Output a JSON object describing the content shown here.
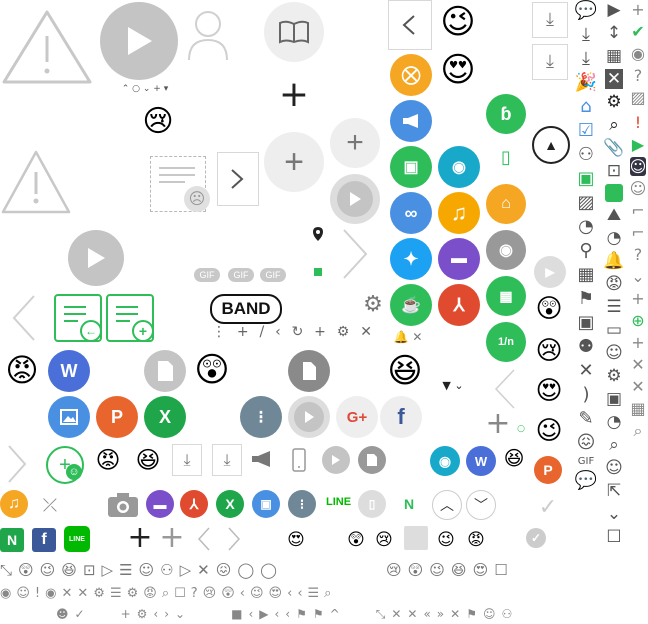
{
  "labels": {
    "band": "BAND",
    "gif": "GIF",
    "line": "LINE",
    "w": "W",
    "p": "P",
    "x": "X",
    "n": "N",
    "g_plus": "G+",
    "f": "f",
    "one_over_n": "1/n"
  },
  "colors": {
    "orange": "#f5a623",
    "blue": "#4a90e2",
    "green": "#2ebd59",
    "purple": "#7b4fc9",
    "red": "#e04b2f",
    "gray": "#c4c4c4",
    "dark_gray": "#8a8a8a",
    "yellow_orange": "#f7a800",
    "teal": "#18a8c9",
    "twitter": "#1da1f2",
    "facebook": "#3b5998",
    "line": "#00b900"
  },
  "icons": [
    "warning-icon",
    "play-icon",
    "person-icon",
    "book-icon",
    "plus-icon",
    "chevron-left-icon",
    "chevron-right-icon",
    "download-icon",
    "chat-icon",
    "emoji-icon",
    "megaphone-icon",
    "bell-icon",
    "camera-icon",
    "calendar-icon",
    "gear-icon",
    "search-icon",
    "close-icon",
    "apple-icon",
    "google-play-icon",
    "music-icon",
    "link-icon",
    "twitter-icon",
    "pdf-icon",
    "video-icon",
    "image-icon",
    "document-icon",
    "checkmark-icon",
    "pin-icon",
    "reload-icon"
  ]
}
